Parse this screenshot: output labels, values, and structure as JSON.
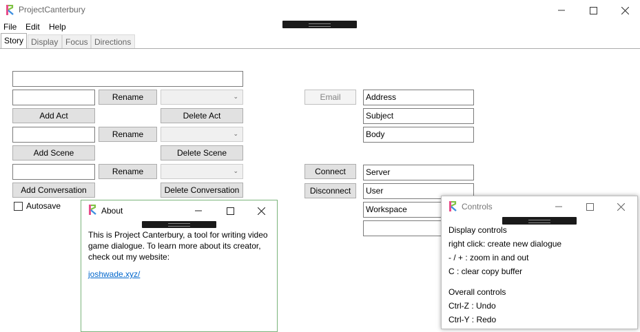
{
  "window": {
    "title": "ProjectCanterbury",
    "accent_colors": [
      "#e84d8a",
      "#7ec242",
      "#3d8fe0"
    ]
  },
  "menu": [
    "File",
    "Edit",
    "Help"
  ],
  "tabs": [
    {
      "label": "Story",
      "active": true
    },
    {
      "label": "Display",
      "active": false
    },
    {
      "label": "Focus",
      "active": false
    },
    {
      "label": "Directions",
      "active": false
    }
  ],
  "story": {
    "title_value": "",
    "act": {
      "name_value": "",
      "rename_label": "Rename",
      "add_label": "Add Act",
      "delete_label": "Delete Act",
      "selected": ""
    },
    "scene": {
      "name_value": "",
      "rename_label": "Rename",
      "add_label": "Add Scene",
      "delete_label": "Delete Scene",
      "selected": ""
    },
    "conversation": {
      "name_value": "",
      "rename_label": "Rename",
      "add_label": "Add Conversation",
      "delete_label": "Delete Conversation",
      "selected": ""
    },
    "autosave_label": "Autosave",
    "autosave_checked": false
  },
  "email": {
    "button_label": "Email",
    "address_value": "Address",
    "subject_value": "Subject",
    "body_value": "Body"
  },
  "server": {
    "connect_label": "Connect",
    "disconnect_label": "Disconnect",
    "server_value": "Server",
    "user_value": "User",
    "workspace_value": "Workspace",
    "extra_value": ""
  },
  "about": {
    "title": "About",
    "text": "This is Project Canterbury, a tool for writing video game dialogue. To learn more about its creator, check out my website:",
    "link": "joshwade.xyz/"
  },
  "controls": {
    "title": "Controls",
    "display_heading": "Display controls",
    "display_lines": [
      "right click: create new dialogue",
      "- / + : zoom in and out",
      "C : clear copy buffer"
    ],
    "overall_heading": "Overall controls",
    "overall_lines": [
      "Ctrl-Z : Undo",
      "Ctrl-Y : Redo"
    ]
  }
}
